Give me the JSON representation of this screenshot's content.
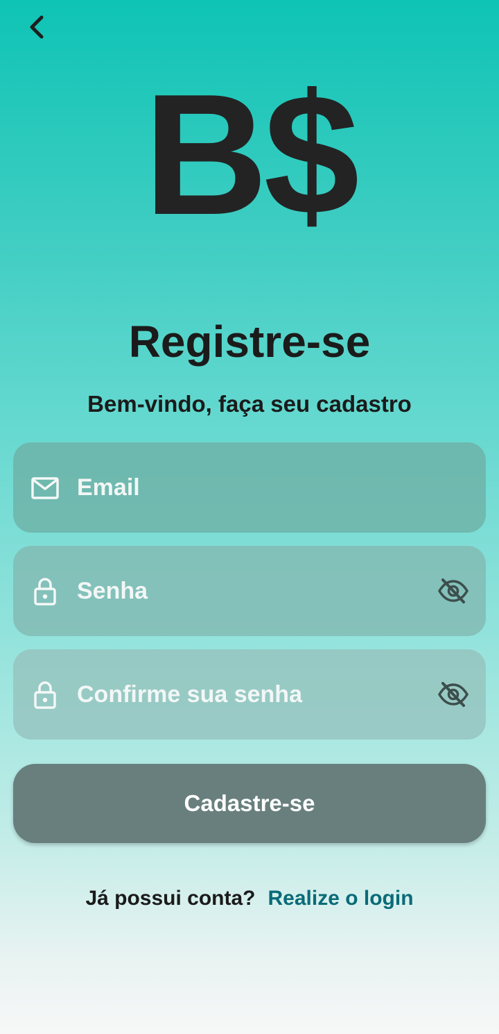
{
  "header": {
    "back_icon": "chevron-left-icon"
  },
  "logo": {
    "text": "B$"
  },
  "title": "Registre-se",
  "subtitle": "Bem-vindo, faça seu cadastro",
  "form": {
    "email": {
      "placeholder": "Email",
      "value": "",
      "icon": "mail-icon"
    },
    "password": {
      "placeholder": "Senha",
      "value": "",
      "icon": "lock-icon",
      "toggle_icon": "eye-off-icon"
    },
    "confirm_password": {
      "placeholder": "Confirme sua senha",
      "value": "",
      "icon": "lock-icon",
      "toggle_icon": "eye-off-icon"
    },
    "submit_label": "Cadastre-se"
  },
  "footer": {
    "question": "Já possui conta?",
    "login_link": "Realize o login"
  },
  "colors": {
    "gradient_top": "#0ec4b5",
    "gradient_bottom": "#f7f7f7",
    "button": "#687f7d",
    "link": "#0a6b78",
    "text_dark": "#1b1b1b"
  }
}
